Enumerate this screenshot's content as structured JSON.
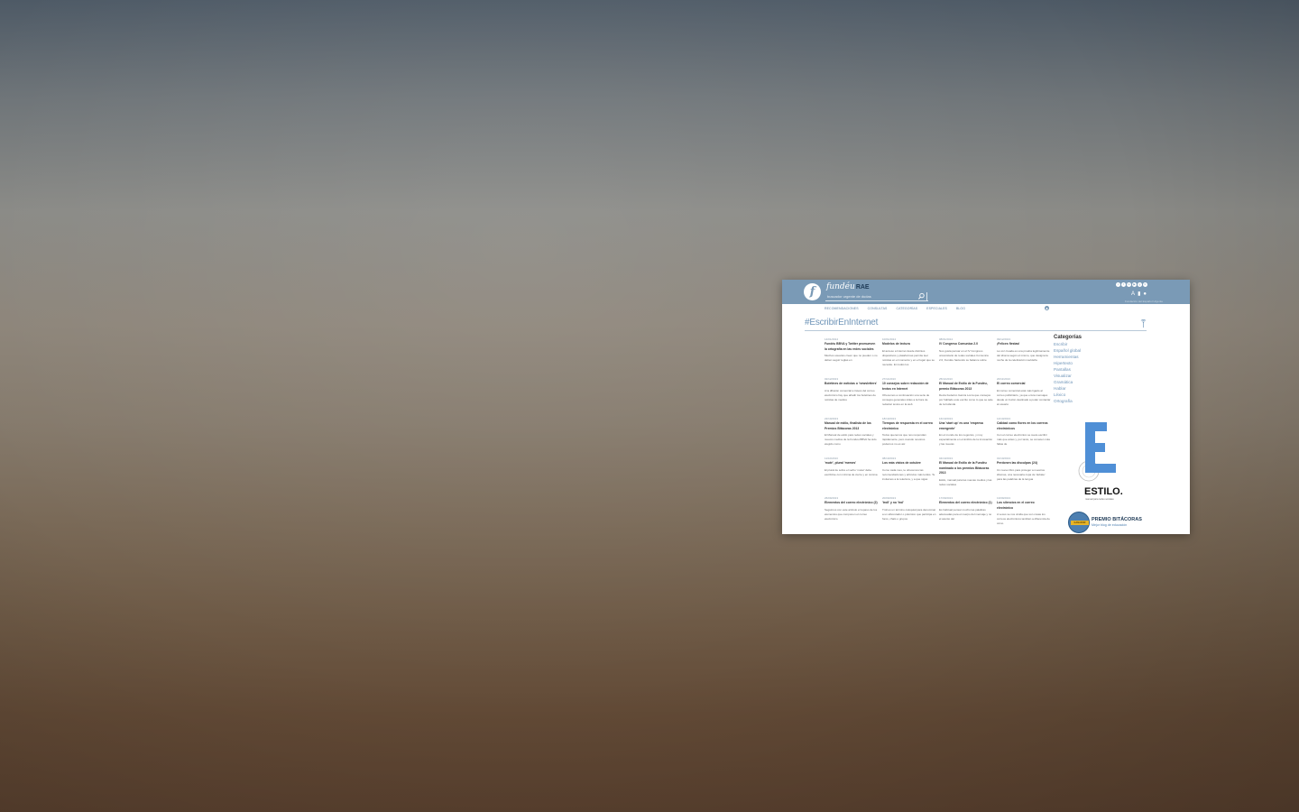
{
  "header": {
    "brand": "fundéu",
    "brand_suffix": "RAE",
    "logo_letter": "f",
    "search_placeholder": "buscador urgente de dudas",
    "social_icons": [
      "twitter-icon",
      "facebook-icon",
      "linkedin-icon",
      "youtube-icon",
      "googleplus-icon",
      "blog-icon"
    ],
    "tool_icons": [
      "text-size-icon",
      "bookmark-icon",
      "mic-icon"
    ],
    "top_note": "Fundación del Español Urgente"
  },
  "nav": {
    "items": [
      "RECOMENDACIONES",
      "CONSULTAS",
      "CATEGORÍAS",
      "ESPECIALES",
      "BLOG"
    ]
  },
  "page": {
    "title": "#EscribirEnInternet"
  },
  "posts": [
    {
      "date": "14/01/2014",
      "title": "Fundéu BBVA y Twitter promueven la ortografía en las redes sociales",
      "excerpt": "Muchos usuarios creen que no pueden o no deben seguir reglas en"
    },
    {
      "date": "10/01/2014",
      "title": "Modelos de lectura",
      "excerpt": "El acceso a Internet desde distintos dispositivos y plataformas permite leer noticias en el momento y en el lugar que se necesite. En todos los"
    },
    {
      "date": "08/01/2014",
      "title": "IV Congreso Comunica 2.0",
      "excerpt": "Nos gusta pensar en el IV Congreso universitario de redes sociales Comunica 2.0, Fundéu haciendo su balance sobre"
    },
    {
      "date": "09/12/2013",
      "title": "¡Felices fiestas!",
      "excerpt": "La voz creada es una prueba legitimamente del idioma según el mismo, que designa la noche de la celebración navideña"
    },
    {
      "date": "02/12/2013",
      "title": "Boletines de noticias o 'newsletters'",
      "excerpt": "A la difusión comercial a través del correo electrónico hay que añadir los boletines de noticias de medios"
    },
    {
      "date": "27/11/2013",
      "title": "10 consejos sobre redacción de textos en Internet",
      "excerpt": "Ofrecemos a continuación una serie de consejos generales útiles a la hora de redactar textos en la web"
    },
    {
      "date": "25/11/2013",
      "title": "El Manual de Estilo de la Fundéu, premio Bitácoras 2013",
      "excerpt": "Decía Federico García Lorca que consejos por hablado este escrito como lo que se sale de la bufanda"
    },
    {
      "date": "20/11/2013",
      "title": "El correo comercial",
      "excerpt": "El correo comercial está más ligado al correo publicitario, ya que envía mensajes desde un buzón destinado a poder contactar al usuario"
    },
    {
      "date": "22/10/2013",
      "title": "Manual de estilo, finalista de los Premios Bitácoras 2013",
      "excerpt": "El Manual de estilo para redes sociales y nuevos medios de la Fundéu BBVA ha sido elegido como"
    },
    {
      "date": "18/10/2013",
      "title": "Tiempos de respuesta en el correo electrónico",
      "excerpt": "Todos queremos que nos respondan rápidamente, pero cuando nosotros podemos no es así"
    },
    {
      "date": "16/10/2013",
      "title": "Una 'start up' es una 'empresa emergente'",
      "excerpt": "En el mundo de los negocios, y muy especialmente en el ámbito de la innovación y las nuevas"
    },
    {
      "date": "14/10/2013",
      "title": "Calidad como flores en los correos electrónicos",
      "excerpt": "Con el correo electrónico se suele escribir más que antes y, por tanto, se cometen más faltas de"
    },
    {
      "date": "11/10/2013",
      "title": "'muté', plural 'memes'",
      "excerpt": "El plural de sobre el verbo 'mutar' debe escribirse con mínima de cierre y en cursiva"
    },
    {
      "date": "08/10/2013",
      "title": "Los más vistos de octubre",
      "excerpt": "Como cada mes, te ofrecemos las recomendaciones y artículos más leídos. Te invitamos a la relectura, y a que sigas"
    },
    {
      "date": "04/10/2013",
      "title": "El Manual de Estilo de la Fundéu nominado a los premios Bitácoras 2013",
      "excerpt": "Estilo, manual para las nuevas medios y las redes sociales"
    },
    {
      "date": "01/10/2013",
      "title": "Perdonen las disculpas (24)",
      "excerpt": "Un nuevo libro para proteger a nuestros idiomas, una necesaria copa de 'debate' para las palabras de la lengua"
    },
    {
      "date": "26/09/2013",
      "title": "Elementos del correo electrónico (2)",
      "excerpt": "Seguimos con este artículo el repaso de los elementos que componen el correo electrónico"
    },
    {
      "date": "20/09/2013",
      "title": "'troll' y no 'trol'",
      "excerpt": "Troll es un término coloquial para denominar a un alborotador o polémico que participa en foros, chats o grupos"
    },
    {
      "date": "17/09/2013",
      "title": "Elementos del correo electrónico (1)",
      "excerpt": "Es habitual pensar mucho las palabras adecuadas para el cuerpo del mensaje y no el asunto del"
    },
    {
      "date": "13/09/2013",
      "title": "Los silencios en el correo electrónico",
      "excerpt": "A veces se nos olvida que son cosas los correos electrónicos también a diferencia de cómo"
    }
  ],
  "sidebar": {
    "heading": "Categorías",
    "links": [
      "Escribir",
      "Español global",
      "Herramientas",
      "Hipertexto",
      "Pantallas",
      "Visualizar",
      "Gramática",
      "Hablar",
      "Léxico",
      "Ortografía"
    ]
  },
  "estilo_banner": {
    "letter": "E",
    "word": "ESTILO.",
    "tagline": "manual para redes sociales"
  },
  "award": {
    "ribbon": "GANADOR",
    "title": "PREMIO BITÁCORAS",
    "subtitle": "Mejor blog de educación"
  },
  "colors": {
    "header_bg": "#7a9ab6",
    "accent": "#6f95b8",
    "nav_text": "#5c7fa2",
    "estilo_blue": "#4f8fd6"
  }
}
